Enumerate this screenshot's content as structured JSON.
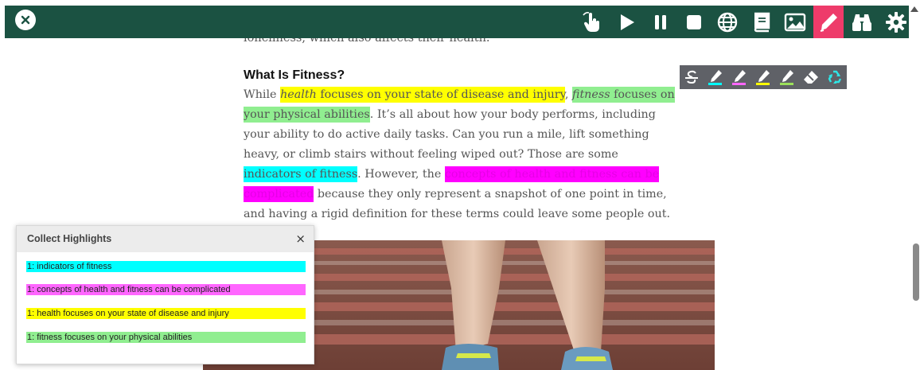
{
  "toolbar": {
    "close_icon": "close-icon",
    "buttons": [
      {
        "name": "hand-pointer-icon"
      },
      {
        "name": "play-icon"
      },
      {
        "name": "pause-icon"
      },
      {
        "name": "stop-icon"
      },
      {
        "name": "globe-icon"
      },
      {
        "name": "book-icon"
      },
      {
        "name": "image-icon"
      },
      {
        "name": "highlighter-pen-icon",
        "active": true
      },
      {
        "name": "binoculars-icon"
      },
      {
        "name": "gear-icon"
      }
    ],
    "colors": {
      "bar": "#1b5242",
      "active": "#ee3b6a"
    }
  },
  "palette": {
    "tools": [
      "strikethrough-icon",
      "cyan-highlighter-icon",
      "pink-highlighter-icon",
      "yellow-highlighter-icon",
      "green-highlighter-icon",
      "eraser-icon",
      "recycle-icon"
    ]
  },
  "article": {
    "faded_line": "loneliness, which also affects their health.",
    "heading": "What Is Fitness?",
    "p": {
      "t1": "While ",
      "h1_em": "health",
      "h1_rest": " focuses on your state of disease and injury",
      "t2": ", ",
      "h2_em": "fitness",
      "h2_rest": " focuses on your physical abilities",
      "t3": ". It’s all about how your body performs, including your ability to do active daily tasks. Can you run a mile, lift something heavy, or climb stairs without feeling wiped out? Those are some ",
      "h3": "indicators of fitness",
      "t4": ". However, the ",
      "h4": "concepts of health and fitness can be complicated",
      "t5": " because they only represent a snapshot of one point in time, and having a rigid definition for these terms could leave some people out."
    }
  },
  "panel": {
    "title": "Collect Highlights",
    "close": "×",
    "items": [
      {
        "text": "1: indicators of fitness",
        "color": "#00ffff"
      },
      {
        "text": "1: concepts of health and fitness can be complicated",
        "color": "#ff66ff"
      },
      {
        "text": "1: health focuses on your state of disease and injury",
        "color": "#ffff00"
      },
      {
        "text": "1: fitness focuses on your physical abilities",
        "color": "#90ee90"
      }
    ]
  }
}
